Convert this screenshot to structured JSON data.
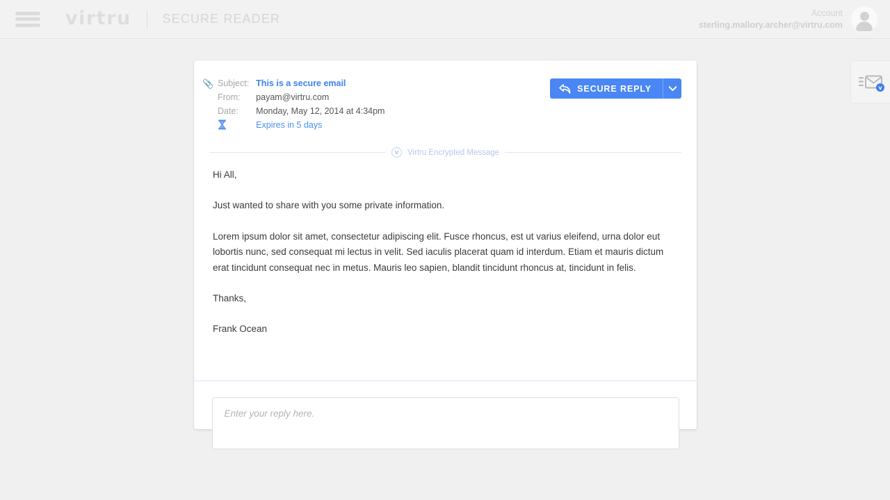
{
  "header": {
    "menu_icon": "hamburger-menu-icon",
    "brand": "virtru",
    "product": "SECURE READER",
    "account_label": "Account",
    "account_email": "sterling.mallory.archer@virtru.com",
    "avatar_icon": "user-avatar-icon"
  },
  "message": {
    "attachment_icon": "paperclip-icon",
    "expiry_icon": "hourglass-icon",
    "labels": {
      "subject": "Subject:",
      "from": "From:",
      "date": "Date:"
    },
    "subject": "This is a secure email",
    "from": "payam@virtru.com",
    "date": "Monday, May 12, 2014 at 4:34pm",
    "expires": "Expires in 5 days",
    "encrypted_banner": "Virtru Encrypted Message",
    "encrypted_badge_glyph": "v",
    "body": {
      "greeting": "Hi All,",
      "intro": "Just wanted to share with you some private information.",
      "paragraph": "Lorem ipsum dolor sit amet, consectetur adipiscing elit. Fusce rhoncus, est ut varius eleifend, urna dolor eut lobortis nunc, sed consequat mi lectus in velit. Sed iaculis placerat quam id interdum. Etiam et mauris dictum erat tincidunt consequat nec in metus. Mauris leo sapien, blandit tincidunt rhoncus at, tincidunt in felis.",
      "signoff": "Thanks,",
      "signature": "Frank Ocean"
    }
  },
  "actions": {
    "secure_reply_label": "SECURE REPLY",
    "secure_reply_icon": "reply-arrow-icon",
    "dropdown_icon": "chevron-down-icon"
  },
  "reply": {
    "placeholder": "Enter your reply here.",
    "value": ""
  },
  "side_tab": {
    "icon": "secure-mail-icon",
    "badge_glyph": "v"
  },
  "colors": {
    "accent_blue": "#4a87f5",
    "link_blue": "#4a90f2",
    "subject_blue": "#3f82f0",
    "encrypted_blue": "#b4c8ef",
    "page_bg": "#f0f0f0",
    "header_bg": "#f2f2f2",
    "card_bg": "#ffffff"
  }
}
